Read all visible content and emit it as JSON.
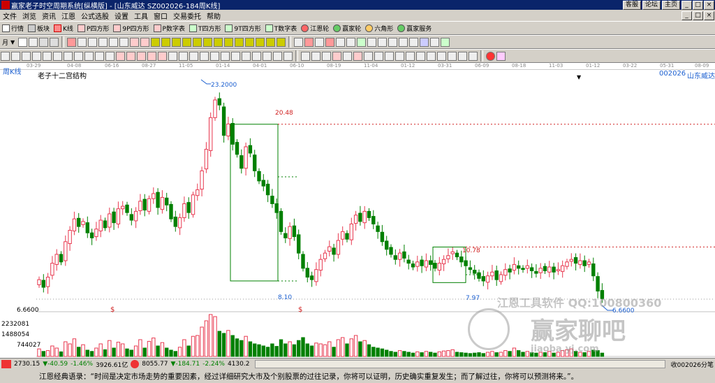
{
  "titlebar": {
    "title": "赢家老子时空周期系统[纵横版] - [山东威达   SZ002026-184周K线]",
    "buttons": [
      "客服",
      "论坛",
      "主页"
    ]
  },
  "menu": [
    "文件",
    "浏览",
    "资讯",
    "江恩",
    "公式选股",
    "设置",
    "工具",
    "窗口",
    "交易委托",
    "帮助"
  ],
  "toolbar1": [
    "行情",
    "板块",
    "K线",
    "P四方形",
    "9P四方形",
    "P数字表",
    "T四方形",
    "9T四方形",
    "T数字表",
    "江恩轮",
    "赢家轮",
    "六角形",
    "赢家服务"
  ],
  "toolbar2_period": "月",
  "chart": {
    "period_label": "周K线",
    "indicator_title": "老子十二宫结构",
    "stock_code": "002026",
    "stock_name": "山东威达",
    "date_ticks": [
      "03-29",
      "04-08",
      "06-16",
      "08-27",
      "11-05",
      "01-14",
      "04-01",
      "06-10",
      "08-19",
      "11-04",
      "01-12",
      "03-31",
      "06-09",
      "08-18",
      "11-03",
      "01-12",
      "03-22",
      "05-31",
      "08-09"
    ],
    "price_high": "23.2000",
    "box1_top": "20.48",
    "box1_bottom": "8.10",
    "box2_top": "10.78",
    "box2_bottom": "7.97",
    "price_low": "6.6600",
    "left_price": "6.6600",
    "volume_ticks": [
      "2232081",
      "1488054",
      "744027"
    ]
  },
  "watermark": {
    "text1": "江恩工具软件  QQ:100800360",
    "text2": "赢家聊吧",
    "text3": "jiaoba.yj.com"
  },
  "statusbar": {
    "idx1": "2730.15",
    "idx1_chg": "▼-40.59",
    "idx1_pct": "-1.46%",
    "idx1_amt": "3926.61亿",
    "idx2": "8055.77",
    "idx2_chg": "▼-184.71",
    "idx2_pct": "-2.24%",
    "idx2_amt": "4130.2",
    "right": "收002026分笔"
  },
  "quote": "江恩经典语录：“时间是决定市场走势的重要因素，经过详细研究大市及个别股票的过往记录，你将可以证明，历史确实重复发生；而了解过往，你将可以预测将来。”。",
  "colors": {
    "up": "#e8384f",
    "down": "#008000",
    "accent": "#0a246a",
    "label_blue": "#1b5fd0",
    "box_red": "#d02020"
  },
  "chart_data": {
    "type": "candlestick",
    "y_range": [
      6.0,
      24.0
    ],
    "key_levels": {
      "high": 23.2,
      "box1_top": 20.48,
      "box1_bottom": 8.1,
      "box2_top": 10.78,
      "box2_bottom": 7.97,
      "low": 6.66
    },
    "closes": [
      8.2,
      7.6,
      8.4,
      9.5,
      10.2,
      9.6,
      11.2,
      12.1,
      13.0,
      12.4,
      12.8,
      11.9,
      11.5,
      12.2,
      12.9,
      12.3,
      13.4,
      12.7,
      13.8,
      14.0,
      13.5,
      12.9,
      13.6,
      14.4,
      13.7,
      14.6,
      15.0,
      13.9,
      14.7,
      14.1,
      13.0,
      12.4,
      13.1,
      14.2,
      13.5,
      14.9,
      15.3,
      16.8,
      18.5,
      21.0,
      22.4,
      22.0,
      19.6,
      20.5,
      18.9,
      18.1,
      17.0,
      18.7,
      18.2,
      16.8,
      16.0,
      15.6,
      14.9,
      14.2,
      13.5,
      12.0,
      11.5,
      12.4,
      11.6,
      10.3,
      9.1,
      8.4,
      8.2,
      9.0,
      9.8,
      10.3,
      10.8,
      10.2,
      11.3,
      12.0,
      11.4,
      12.6,
      13.3,
      12.8,
      13.6,
      13.1,
      12.6,
      12.0,
      11.2,
      10.6,
      10.2,
      9.8,
      10.3,
      9.9,
      9.5,
      9.2,
      9.6,
      9.3,
      9.7,
      9.4,
      9.1,
      9.5,
      9.8,
      10.1,
      10.4,
      10.0,
      9.6,
      9.3,
      9.0,
      8.7,
      8.3,
      8.1,
      8.5,
      8.8,
      8.2,
      8.6,
      9.0,
      8.8,
      9.4,
      9.1,
      9.0,
      9.3,
      8.9,
      8.7,
      9.1,
      8.9,
      9.2,
      8.8,
      9.0,
      9.3,
      9.6,
      9.8,
      9.5,
      9.7,
      9.3,
      9.6,
      8.5,
      7.3,
      6.7
    ],
    "volumes": [
      0.18,
      0.12,
      0.14,
      0.25,
      0.2,
      0.11,
      0.35,
      0.3,
      0.42,
      0.22,
      0.28,
      0.15,
      0.12,
      0.2,
      0.3,
      0.16,
      0.38,
      0.2,
      0.34,
      0.3,
      0.18,
      0.15,
      0.25,
      0.4,
      0.2,
      0.36,
      0.44,
      0.25,
      0.33,
      0.2,
      0.15,
      0.12,
      0.22,
      0.4,
      0.25,
      0.48,
      0.5,
      0.7,
      0.85,
      1.0,
      0.95,
      0.6,
      0.55,
      0.62,
      0.5,
      0.42,
      0.38,
      0.48,
      0.35,
      0.3,
      0.28,
      0.25,
      0.22,
      0.3,
      0.24,
      0.4,
      0.3,
      0.35,
      0.28,
      0.38,
      0.45,
      0.3,
      0.25,
      0.32,
      0.3,
      0.28,
      0.35,
      0.22,
      0.4,
      0.45,
      0.3,
      0.42,
      0.5,
      0.35,
      0.38,
      0.28,
      0.22,
      0.2,
      0.18,
      0.15,
      0.12,
      0.1,
      0.14,
      0.12,
      0.1,
      0.08,
      0.11,
      0.09,
      0.12,
      0.1,
      0.08,
      0.11,
      0.13,
      0.14,
      0.16,
      0.1,
      0.09,
      0.08,
      0.07,
      0.08,
      0.09,
      0.07,
      0.1,
      0.12,
      0.09,
      0.1,
      0.14,
      0.12,
      0.2,
      0.14,
      0.1,
      0.12,
      0.09,
      0.08,
      0.1,
      0.09,
      0.12,
      0.08,
      0.1,
      0.14,
      0.16,
      0.18,
      0.12,
      0.1,
      0.09,
      0.12,
      0.15,
      0.14,
      0.08
    ]
  }
}
